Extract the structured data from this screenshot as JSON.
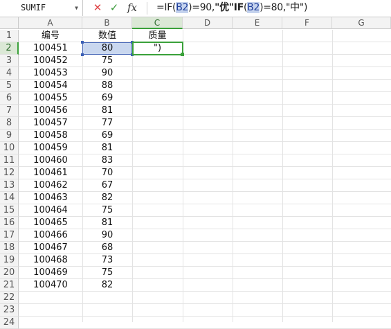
{
  "formula_bar": {
    "name_box": "SUMIF",
    "cancel_glyph": "✕",
    "enter_glyph": "✓",
    "fx_label": "fx",
    "formula_parts": [
      "=IF(",
      "B2",
      ")=90,",
      "\"优\"",
      "IF",
      "(",
      "B2",
      ")=80,\"中\")"
    ]
  },
  "columns": [
    "A",
    "B",
    "C",
    "D",
    "E",
    "F",
    "G"
  ],
  "rows": [
    "1",
    "2",
    "3",
    "4",
    "5",
    "6",
    "7",
    "8",
    "9",
    "10",
    "11",
    "12",
    "13",
    "14",
    "15",
    "16",
    "17",
    "18",
    "19",
    "20",
    "21",
    "22",
    "23",
    "24"
  ],
  "headers": {
    "a": "编号",
    "b": "数值",
    "c": "质量"
  },
  "c2_edit_text": "\")",
  "data_rows": [
    {
      "id": "100451",
      "value": "80"
    },
    {
      "id": "100452",
      "value": "75"
    },
    {
      "id": "100453",
      "value": "90"
    },
    {
      "id": "100454",
      "value": "88"
    },
    {
      "id": "100455",
      "value": "69"
    },
    {
      "id": "100456",
      "value": "81"
    },
    {
      "id": "100457",
      "value": "77"
    },
    {
      "id": "100458",
      "value": "69"
    },
    {
      "id": "100459",
      "value": "81"
    },
    {
      "id": "100460",
      "value": "83"
    },
    {
      "id": "100461",
      "value": "70"
    },
    {
      "id": "100462",
      "value": "67"
    },
    {
      "id": "100463",
      "value": "82"
    },
    {
      "id": "100464",
      "value": "75"
    },
    {
      "id": "100465",
      "value": "81"
    },
    {
      "id": "100466",
      "value": "90"
    },
    {
      "id": "100467",
      "value": "68"
    },
    {
      "id": "100468",
      "value": "73"
    },
    {
      "id": "100469",
      "value": "75"
    },
    {
      "id": "100470",
      "value": "82"
    }
  ],
  "colors": {
    "accent_green": "#3aa13a",
    "ref_blue": "#4a69b8"
  }
}
